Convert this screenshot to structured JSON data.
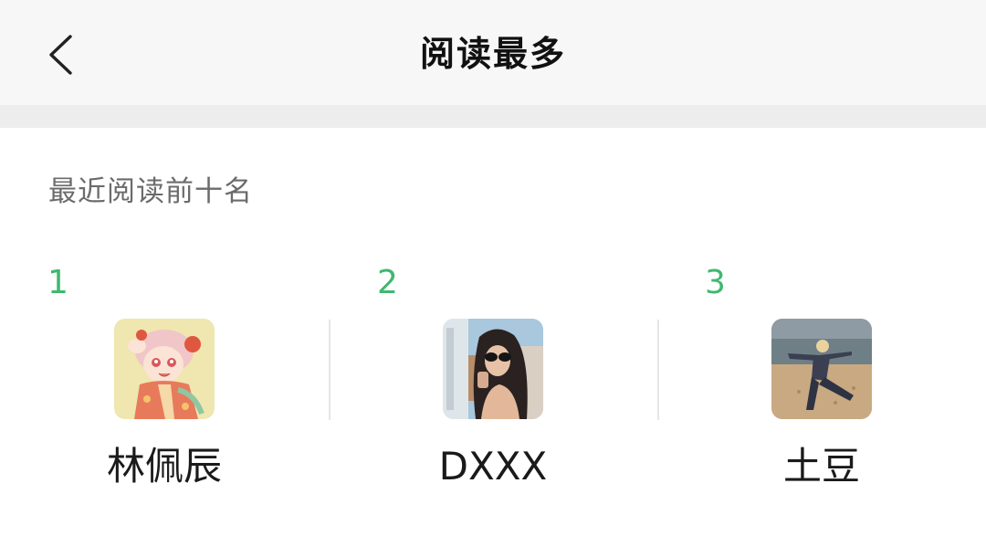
{
  "header": {
    "title": "阅读最多",
    "back_icon": "chevron-left-icon"
  },
  "section": {
    "label": "最近阅读前十名"
  },
  "ranking": [
    {
      "rank": "1",
      "name": "林佩辰",
      "avatar_icon": "anime-character-avatar"
    },
    {
      "rank": "2",
      "name": "DXXX",
      "avatar_icon": "selfie-photo-avatar"
    },
    {
      "rank": "3",
      "name": "土豆",
      "avatar_icon": "beach-photo-avatar"
    }
  ],
  "colors": {
    "rank_green": "#3fb86f",
    "header_bg": "#f7f7f7",
    "band_bg": "#ededed"
  }
}
